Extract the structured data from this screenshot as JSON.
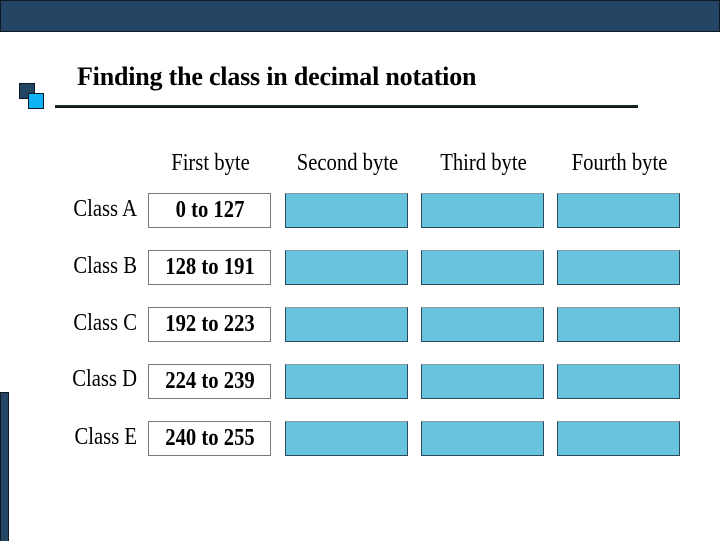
{
  "slide": {
    "title": "Finding the class in decimal notation",
    "colors": {
      "bar_dark": "#234463",
      "bullet_light": "#0fb2f2",
      "byte_fill": "#68c4de"
    }
  },
  "table": {
    "column_headers": [
      "First byte",
      "Second byte",
      "Third byte",
      "Fourth byte"
    ],
    "rows": [
      {
        "label": "Class A",
        "first_byte_range": "0 to 127"
      },
      {
        "label": "Class B",
        "first_byte_range": "128 to 191"
      },
      {
        "label": "Class C",
        "first_byte_range": "192 to 223"
      },
      {
        "label": "Class D",
        "first_byte_range": "224 to 239"
      },
      {
        "label": "Class E",
        "first_byte_range": "240 to 255"
      }
    ]
  }
}
